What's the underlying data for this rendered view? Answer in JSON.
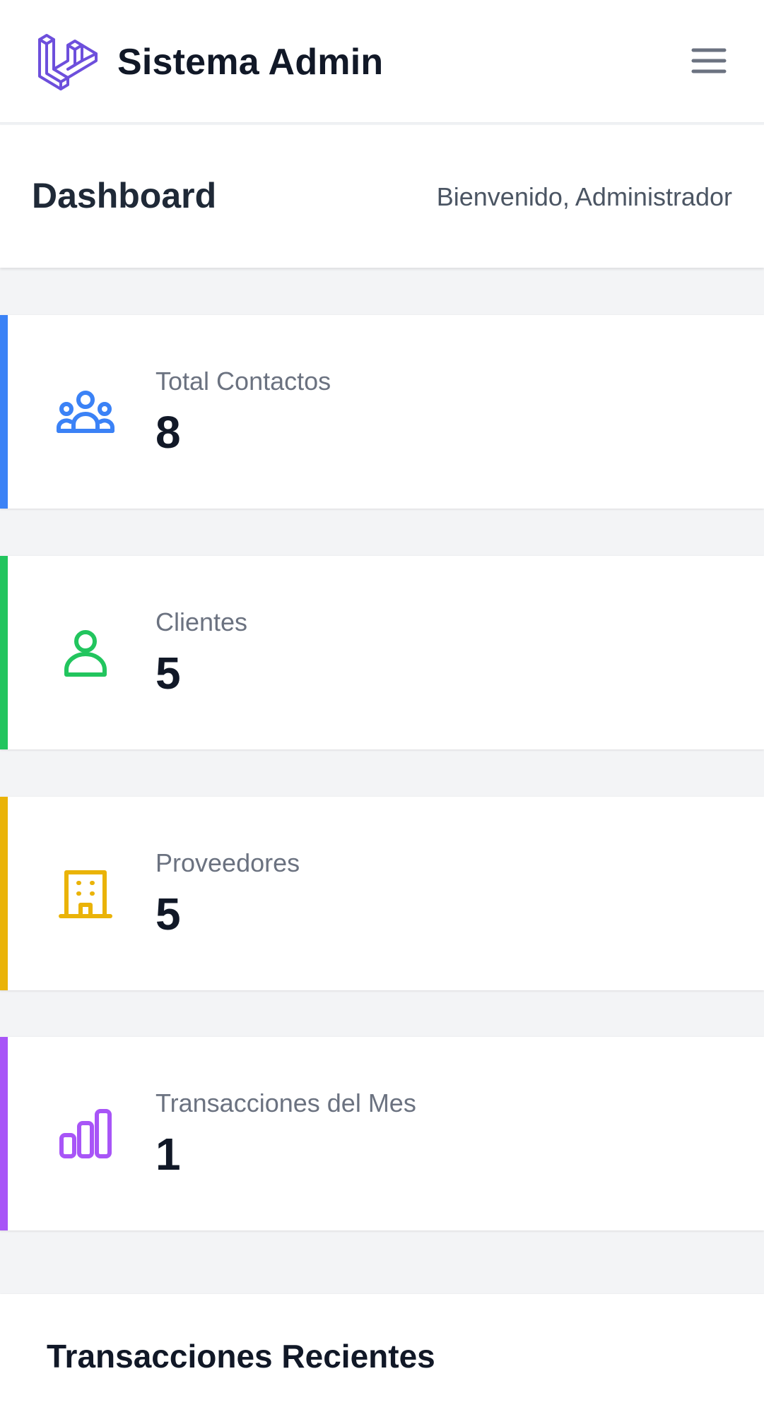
{
  "app": {
    "name": "Sistema Admin"
  },
  "header": {
    "title": "Dashboard",
    "welcome": "Bienvenido, Administrador"
  },
  "stats": [
    {
      "label": "Total Contactos",
      "value": "8",
      "icon": "users-group-icon",
      "color": "#3b82f6"
    },
    {
      "label": "Clientes",
      "value": "5",
      "icon": "user-icon",
      "color": "#22c55e"
    },
    {
      "label": "Proveedores",
      "value": "5",
      "icon": "building-icon",
      "color": "#eab308"
    },
    {
      "label": "Transacciones del Mes",
      "value": "1",
      "icon": "bar-chart-icon",
      "color": "#a855f7"
    }
  ],
  "recent": {
    "title": "Transacciones Recientes"
  },
  "colors": {
    "brand": "#6d4fdc",
    "menu_icon": "#6b7280"
  }
}
